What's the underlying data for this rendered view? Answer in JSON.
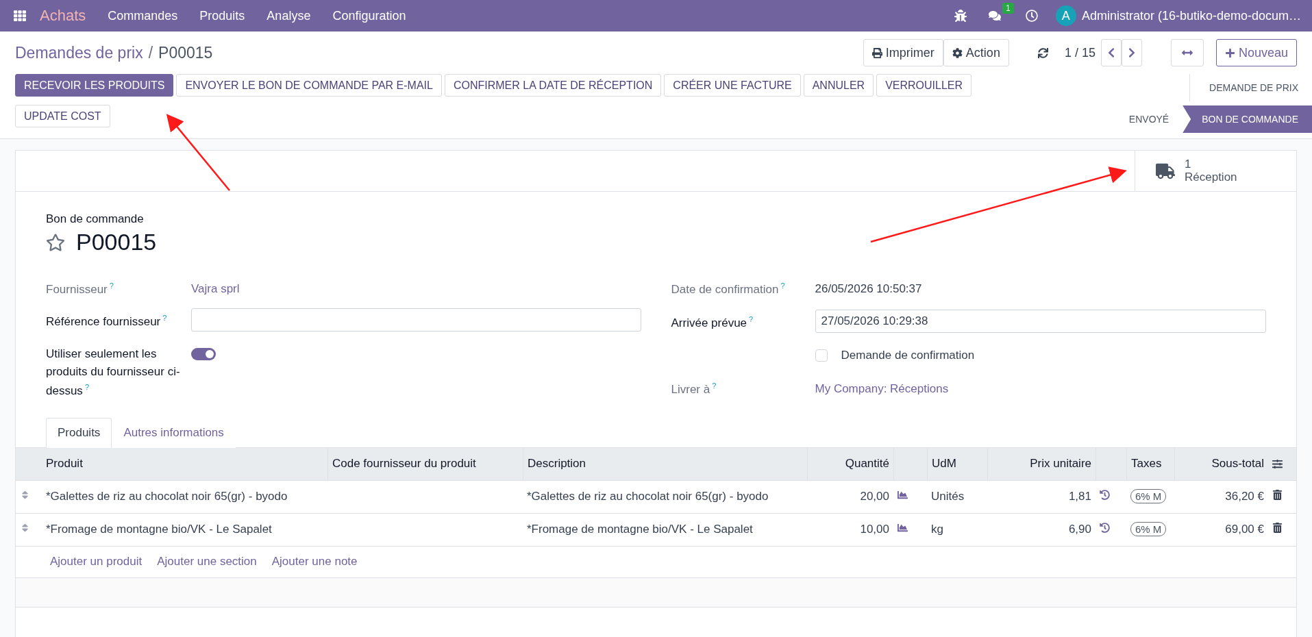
{
  "navbar": {
    "app_name": "Achats",
    "menus": [
      "Commandes",
      "Produits",
      "Analyse",
      "Configuration"
    ],
    "messages_badge": "1",
    "avatar": "A",
    "user": "Administrator (16-butiko-demo-docum…"
  },
  "breadcrumb": {
    "parent": "Demandes de prix",
    "separator": "/",
    "current": "P00015"
  },
  "control": {
    "print": "Imprimer",
    "action": "Action",
    "pager": "1 / 15",
    "new": "Nouveau"
  },
  "buttons": [
    {
      "label": "RECEVOIR LES PRODUITS",
      "primary": true
    },
    {
      "label": "ENVOYER LE BON DE COMMANDE PAR E-MAIL",
      "primary": false
    },
    {
      "label": "CONFIRMER LA DATE DE RÉCEPTION",
      "primary": false
    },
    {
      "label": "CRÉER UNE FACTURE",
      "primary": false
    },
    {
      "label": "ANNULER",
      "primary": false
    },
    {
      "label": "VERROUILLER",
      "primary": false
    },
    {
      "label": "UPDATE COST",
      "primary": false
    }
  ],
  "statusbar": [
    {
      "label": "DEMANDE DE PRIX",
      "selected": false
    },
    {
      "label": "ENVOYÉ",
      "selected": false
    },
    {
      "label": "BON DE COMMANDE",
      "selected": true
    }
  ],
  "smart_button": {
    "count": "1",
    "label": "Réception"
  },
  "form": {
    "caption": "Bon de commande",
    "name": "P00015",
    "starred": false,
    "left_fields": [
      {
        "kind": "link",
        "label": "Fournisseur",
        "help": "?",
        "readonly": true,
        "value": "Vajra sprl"
      },
      {
        "kind": "input",
        "label": "Référence fournisseur",
        "help": "?",
        "readonly": false
      },
      {
        "kind": "toggle",
        "label": "Utiliser seulement les produits du fournisseur ci-dessus",
        "help": "?",
        "readonly": false,
        "on": true
      }
    ],
    "right_fields": [
      {
        "kind": "text",
        "label": "Date de confirmation",
        "help": "?",
        "readonly": true,
        "value": "26/05/2026 10:50:37"
      },
      {
        "kind": "input",
        "label": "Arrivée prévue",
        "help": "?",
        "readonly": false,
        "value": "27/05/2026 10:29:38"
      },
      {
        "kind": "checkbox",
        "value": "Demande de confirmation",
        "checked": false
      },
      {
        "kind": "link",
        "label": "Livrer à",
        "help": "?",
        "readonly": true,
        "value": "My Company: Réceptions"
      }
    ]
  },
  "tabs": [
    {
      "label": "Produits",
      "selected": true
    },
    {
      "label": "Autres informations",
      "selected": false
    }
  ],
  "table": {
    "columns": [
      "Produit",
      "Code fournisseur du produit",
      "Description",
      "Quantité",
      "UdM",
      "Prix unitaire",
      "Taxes",
      "Sous-total"
    ],
    "rows": [
      {
        "product": "*Galettes de riz au chocolat noir 65(gr) - byodo",
        "description": "*Galettes de riz au chocolat noir 65(gr) - byodo",
        "quantity": "20,00",
        "uom": "Unités",
        "price": "1,81",
        "tax": "6% M",
        "subtotal": "36,20 €"
      },
      {
        "product": "*Fromage de montagne bio/VK - Le Sapalet",
        "description": "*Fromage de montagne bio/VK - Le Sapalet",
        "quantity": "10,00",
        "uom": "kg",
        "price": "6,90",
        "tax": "6% M",
        "subtotal": "69,00 €"
      }
    ],
    "add_links": [
      "Ajouter un produit",
      "Ajouter une section",
      "Ajouter une note"
    ]
  }
}
